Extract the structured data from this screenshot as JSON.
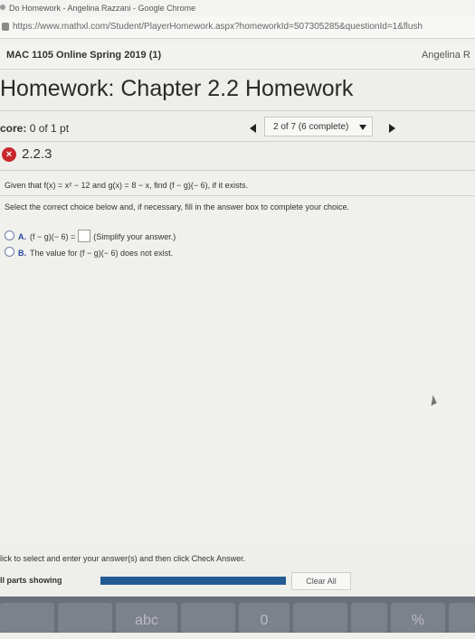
{
  "browser": {
    "window_title": "Do Homework - Angelina Razzani - Google Chrome",
    "url": "https://www.mathxl.com/Student/PlayerHomework.aspx?homeworkId=507305285&questionId=1&flush"
  },
  "header": {
    "course": "MAC 1105 Online Spring 2019 (1)",
    "user": "Angelina R"
  },
  "homework": {
    "title": "Homework: Chapter 2.2 Homework",
    "score_label": "core:",
    "score_value": "0 of 1 pt",
    "nav_position": "2 of 7 (6 complete)"
  },
  "question": {
    "number": "2.2.3",
    "status_symbol": "×",
    "prompt": "Given that f(x) = x² − 12 and g(x) = 8 − x, find (f − g)(− 6), if it exists.",
    "instruction": "Select the correct choice below and, if necessary, fill in the answer box to complete your choice.",
    "options": [
      {
        "letter": "A.",
        "text_before": "(f − g)(− 6) =",
        "text_after": "(Simplify your answer.)"
      },
      {
        "letter": "B.",
        "text": "The value for (f − g)(− 6) does not exist."
      }
    ]
  },
  "footer": {
    "instruction": "lick to select and enter your answer(s) and then click Check Answer.",
    "parts_label": "ll parts showing",
    "parts_progress": 1.0,
    "clear_label": "Clear All"
  },
  "keyboard": {
    "keys": [
      "abc",
      "0",
      "%"
    ]
  },
  "colors": {
    "accent": "#27479a",
    "progress": "#245a93",
    "error": "#c8282d"
  }
}
